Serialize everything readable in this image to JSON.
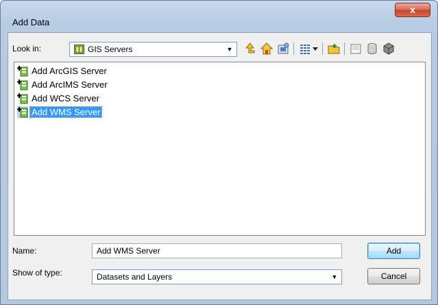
{
  "window": {
    "title": "Add Data",
    "close_label": "x"
  },
  "toolbar": {
    "look_in_label": "Look in:",
    "look_in_value": "GIS Servers",
    "buttons": [
      {
        "name": "up-one-level-icon"
      },
      {
        "name": "home-icon"
      },
      {
        "name": "go-to-default-database-icon"
      },
      {
        "name": "view-list-icon"
      },
      {
        "name": "view-dropdown-icon"
      },
      {
        "name": "connect-to-folder-icon"
      },
      {
        "name": "new-folder-icon"
      },
      {
        "name": "new-database-icon"
      },
      {
        "name": "catalog-icon"
      }
    ]
  },
  "list": {
    "items": [
      {
        "label": "Add ArcGIS Server",
        "selected": false
      },
      {
        "label": "Add ArcIMS Server",
        "selected": false
      },
      {
        "label": "Add WCS Server",
        "selected": false
      },
      {
        "label": "Add WMS Server",
        "selected": true
      }
    ]
  },
  "name": {
    "label": "Name:",
    "value": "Add WMS Server"
  },
  "type": {
    "label": "Show of type:",
    "value": "Datasets and Layers"
  },
  "buttons": {
    "add": "Add",
    "cancel": "Cancel"
  },
  "colors": {
    "selection": "#3399ff",
    "frame": "#b9cde4"
  }
}
